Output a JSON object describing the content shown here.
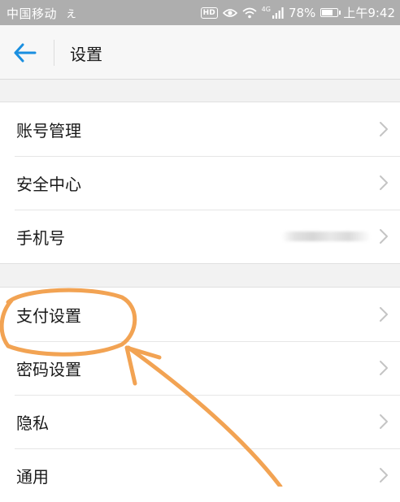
{
  "status_bar": {
    "carrier": "中国移动",
    "carrier_icon": "ぇ",
    "network": "4G",
    "battery": "78%",
    "battery_level": 0.78,
    "time": "上午9:42",
    "hd_badge": "HD",
    "icons": [
      "hd-badge-icon",
      "eye-icon",
      "wifi-icon",
      "signal-icon",
      "battery-icon"
    ]
  },
  "header": {
    "title": "设置",
    "back_icon": "arrow-left-icon"
  },
  "groups": [
    {
      "items": [
        {
          "label": "账号管理",
          "icon": "chevron-right-icon"
        },
        {
          "label": "安全中心",
          "icon": "chevron-right-icon"
        },
        {
          "label": "手机号",
          "icon": "chevron-right-icon",
          "value_masked": true
        }
      ]
    },
    {
      "items": [
        {
          "label": "支付设置",
          "icon": "chevron-right-icon",
          "highlighted": true
        },
        {
          "label": "密码设置",
          "icon": "chevron-right-icon"
        },
        {
          "label": "隐私",
          "icon": "chevron-right-icon"
        },
        {
          "label": "通用",
          "icon": "chevron-right-icon"
        }
      ]
    }
  ],
  "colors": {
    "accent": "#1a8fe0",
    "annotation": "#f2a353",
    "status_bar": "#aeaeae",
    "background": "#f2f2f2"
  }
}
